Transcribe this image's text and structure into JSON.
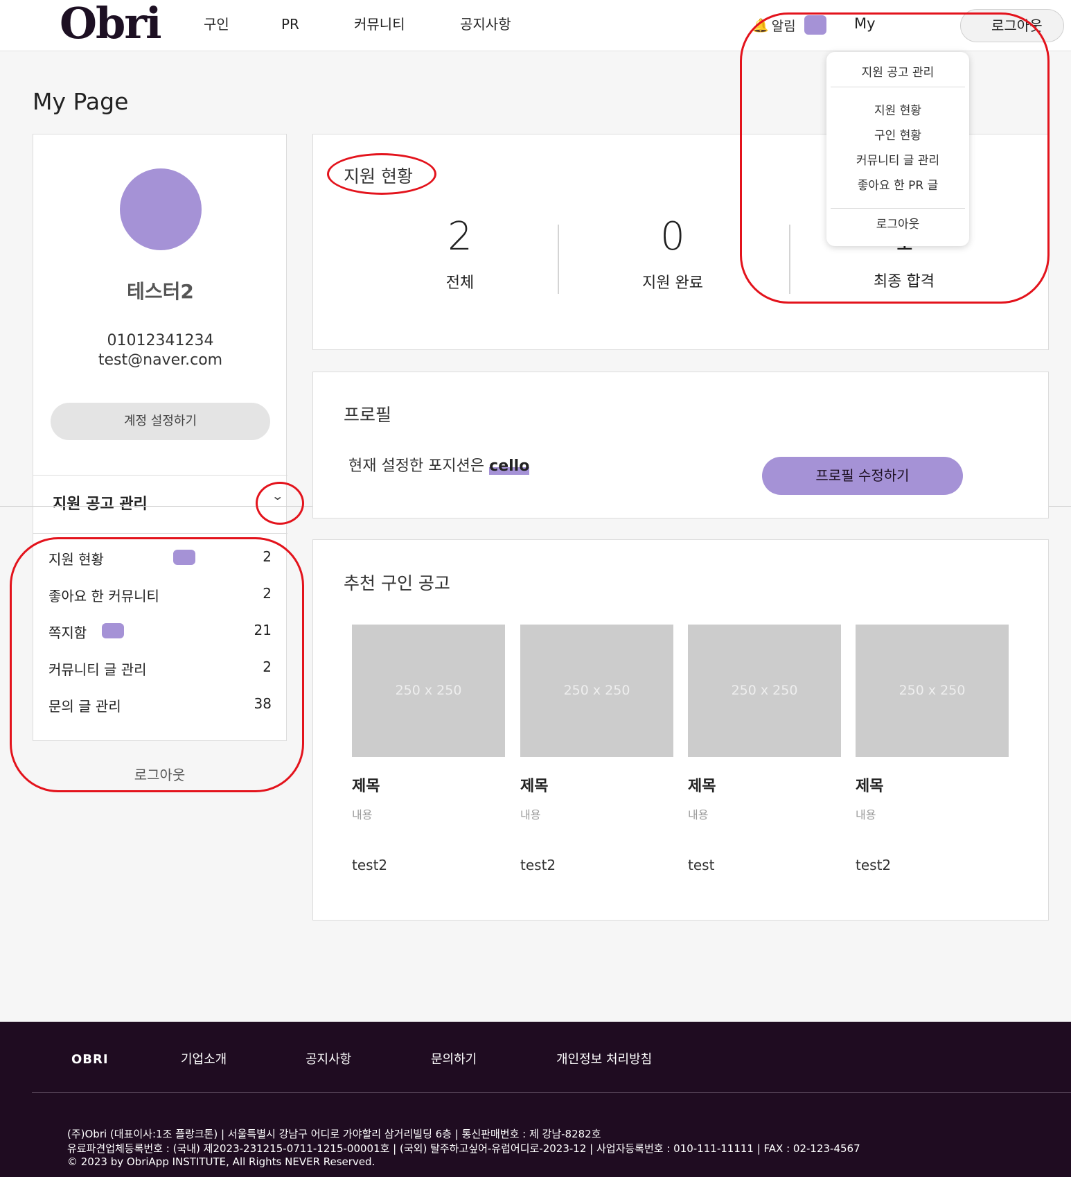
{
  "header": {
    "logo": "Obri",
    "nav": [
      "구인",
      "PR",
      "커뮤니티",
      "공지사항"
    ],
    "alarm_label": "알림",
    "my_label": "My",
    "logout_label": "로그아웃"
  },
  "dropdown": {
    "title": "지원 공고 관리",
    "items": [
      "지원 현황",
      "구인 현황",
      "커뮤니티 글 관리",
      "좋아요 한 PR 글"
    ],
    "logout": "로그아웃"
  },
  "page_title": "My Page",
  "profile": {
    "name": "테스터2",
    "phone": "01012341234",
    "email": "test@naver.com",
    "account_button": "계정 설정하기"
  },
  "sidebar": {
    "section_title": "지원 공고 관리",
    "items": [
      {
        "label": "지원 현황",
        "count": "2"
      },
      {
        "label": "좋아요 한 커뮤니티",
        "count": "2"
      },
      {
        "label": "쪽지함",
        "count": "21"
      },
      {
        "label": "커뮤니티 글 관리",
        "count": "2"
      },
      {
        "label": "문의 글 관리",
        "count": "38"
      }
    ],
    "logout": "로그아웃"
  },
  "status": {
    "title": "지원 현황",
    "stats": [
      {
        "value": "2",
        "label": "전체"
      },
      {
        "value": "0",
        "label": "지원 완료"
      },
      {
        "value": "1",
        "label": "최종 합격"
      }
    ]
  },
  "profile_section": {
    "title": "프로필",
    "text": "현재 설정한 포지션은",
    "position": "cello",
    "edit_button": "프로필 수정하기"
  },
  "recommend": {
    "title": "추천 구인 공고",
    "jobs": [
      {
        "thumb": "250 x 250",
        "title": "제목",
        "content": "내용",
        "author": "test2"
      },
      {
        "thumb": "250 x 250",
        "title": "제목",
        "content": "내용",
        "author": "test2"
      },
      {
        "thumb": "250 x 250",
        "title": "제목",
        "content": "내용",
        "author": "test"
      },
      {
        "thumb": "250 x 250",
        "title": "제목",
        "content": "내용",
        "author": "test2"
      }
    ]
  },
  "footer": {
    "logo": "OBRI",
    "nav": [
      "기업소개",
      "공지사항",
      "문의하기",
      "개인정보 처리방침"
    ],
    "line1": "(주)Obri (대표이사:1조 플랑크톤) | 서울특별시 강남구 어디로 가야할리 삼거리빌딩 6층 | 통신판매번호 : 제 강남-8282호",
    "line2": "유료파견업체등록번호 : (국내) 제2023-231215-0711-1215-00001호 | (국외) 탈주하고싶어-유럽어디로-2023-12 | 사업자등록번호 : 010-111-11111 | FAX : 02-123-4567",
    "line3": "© 2023 by ObriApp INSTITUTE, All Rights NEVER Reserved."
  },
  "colors": {
    "accent": "#a592d6",
    "footer_bg": "#1f0c21",
    "annotation": "#e3131c"
  }
}
